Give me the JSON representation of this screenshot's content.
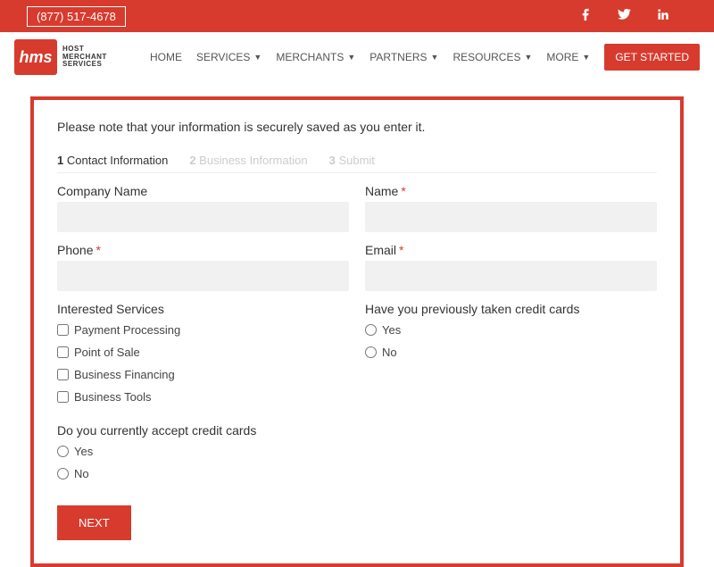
{
  "topbar": {
    "phone": "(877) 517-4678"
  },
  "logo": {
    "mark": "hms",
    "line1": "HOST",
    "line2": "MERCHANT",
    "line3": "SERVICES"
  },
  "nav": {
    "items": [
      {
        "label": "HOME",
        "hasDropdown": false
      },
      {
        "label": "SERVICES",
        "hasDropdown": true
      },
      {
        "label": "MERCHANTS",
        "hasDropdown": true
      },
      {
        "label": "PARTNERS",
        "hasDropdown": true
      },
      {
        "label": "RESOURCES",
        "hasDropdown": true
      },
      {
        "label": "MORE",
        "hasDropdown": true
      }
    ],
    "cta": "GET STARTED"
  },
  "form": {
    "note": "Please note that your information is securely saved as you enter it.",
    "steps": [
      {
        "num": "1",
        "label": "Contact Information"
      },
      {
        "num": "2",
        "label": "Business Information"
      },
      {
        "num": "3",
        "label": "Submit"
      }
    ],
    "fields": {
      "company": {
        "label": "Company Name"
      },
      "name": {
        "label": "Name",
        "required": "*"
      },
      "phone": {
        "label": "Phone",
        "required": "*"
      },
      "email": {
        "label": "Email",
        "required": "*"
      }
    },
    "services": {
      "label": "Interested Services",
      "options": [
        "Payment Processing",
        "Point of Sale",
        "Business Financing",
        "Business Tools"
      ]
    },
    "prev_cards": {
      "label": "Have you previously taken credit cards",
      "options": [
        "Yes",
        "No"
      ]
    },
    "accept_cards": {
      "label": "Do you currently accept credit cards",
      "options": [
        "Yes",
        "No"
      ]
    },
    "next": "NEXT"
  }
}
